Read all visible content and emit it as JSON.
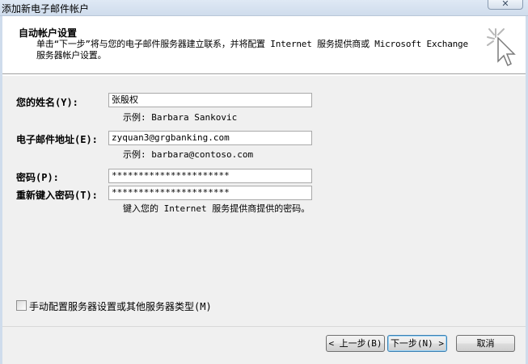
{
  "window": {
    "title": "添加新电子邮件帐户",
    "close_symbol": "✕"
  },
  "header": {
    "title": "自动帐户设置",
    "description": "单击“下一步”将与您的电子邮件服务器建立联系，并将配置 Internet 服务提供商或 Microsoft Exchange 服务器帐户设置。",
    "icon": "wizard-cursor-icon"
  },
  "form": {
    "name_label": "您的姓名(Y):",
    "name_value": "张殷权",
    "name_hint": "示例: Barbara Sankovic",
    "email_label": "电子邮件地址(E):",
    "email_value": "zyquan3@grgbanking.com",
    "email_hint": "示例: barbara@contoso.com",
    "password_label": "密码(P):",
    "password_value": "**********************",
    "retype_label": "重新键入密码(T):",
    "retype_value": "**********************",
    "password_hint": "键入您的 Internet 服务提供商提供的密码。"
  },
  "manual": {
    "label": "手动配置服务器设置或其他服务器类型(M)",
    "checked": false
  },
  "buttons": {
    "back": "< 上一步(B)",
    "next": "下一步(N) >",
    "cancel": "取消"
  },
  "colors": {
    "dialog_bg": "#f0f0f0",
    "header_bg": "#ffffff",
    "default_button_border": "#3c7fb1"
  }
}
